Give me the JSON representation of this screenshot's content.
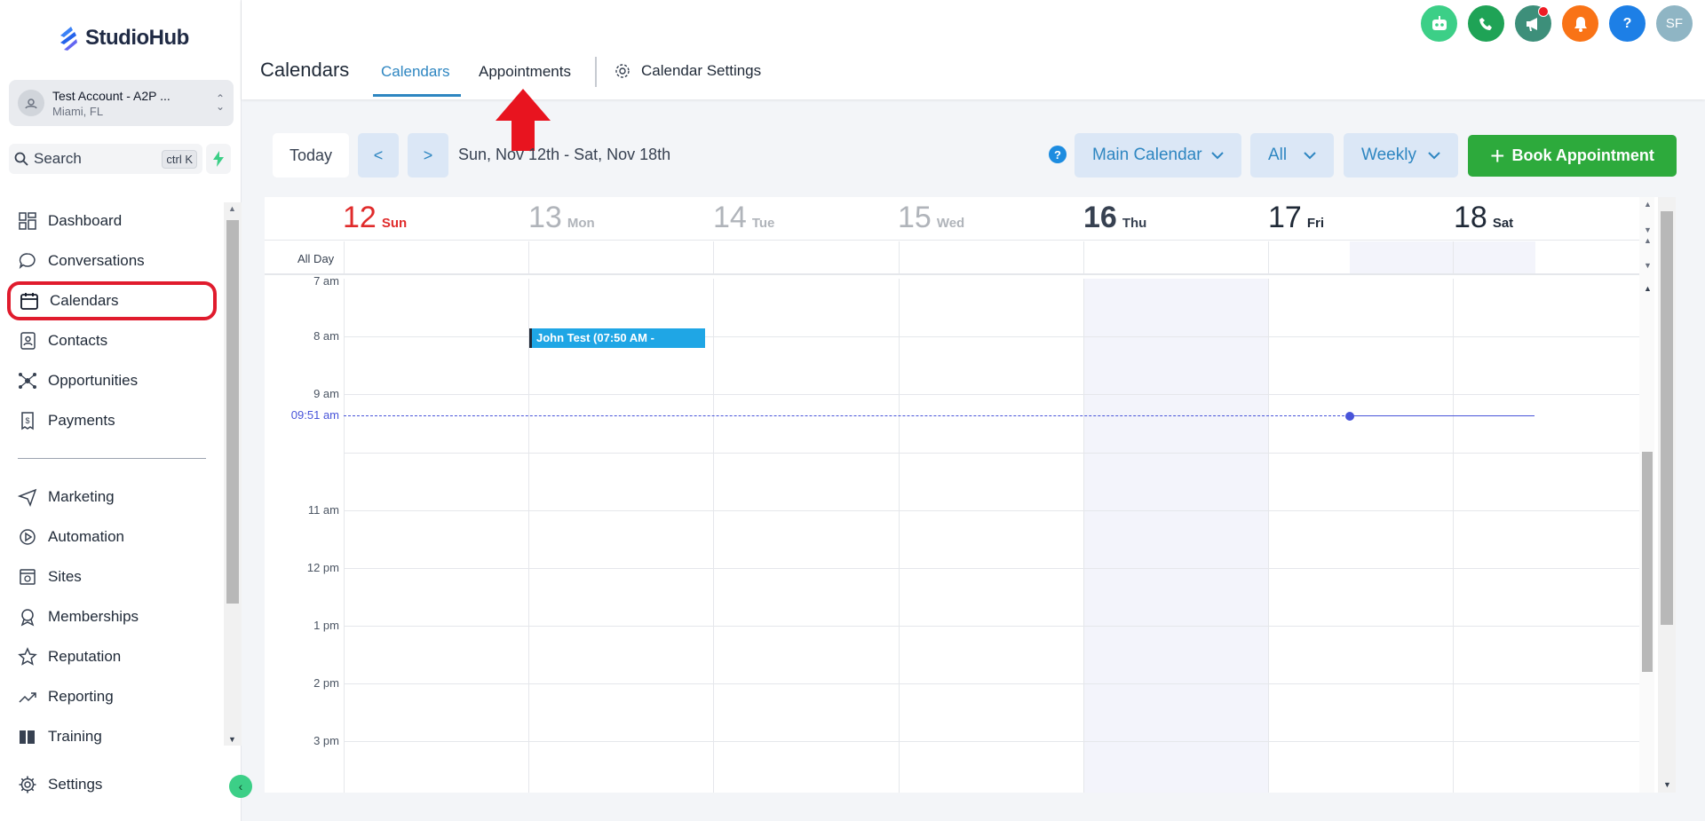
{
  "app": {
    "logo": "StudioHub"
  },
  "account": {
    "name": "Test Account - A2P ...",
    "location": "Miami, FL"
  },
  "search": {
    "label": "Search",
    "shortcut": "ctrl K"
  },
  "nav": {
    "items": [
      {
        "label": "Dashboard",
        "icon": "dashboard-icon"
      },
      {
        "label": "Conversations",
        "icon": "chat-icon"
      },
      {
        "label": "Calendars",
        "icon": "calendar-icon",
        "active": true
      },
      {
        "label": "Contacts",
        "icon": "contacts-icon"
      },
      {
        "label": "Opportunities",
        "icon": "opportunities-icon"
      },
      {
        "label": "Payments",
        "icon": "payments-icon"
      }
    ],
    "items2": [
      {
        "label": "Marketing",
        "icon": "send-icon"
      },
      {
        "label": "Automation",
        "icon": "automation-icon"
      },
      {
        "label": "Sites",
        "icon": "sites-icon"
      },
      {
        "label": "Memberships",
        "icon": "badge-icon"
      },
      {
        "label": "Reputation",
        "icon": "star-icon"
      },
      {
        "label": "Reporting",
        "icon": "trend-icon"
      },
      {
        "label": "Training",
        "icon": "book-icon"
      }
    ],
    "settings": "Settings"
  },
  "header": {
    "title": "Calendars",
    "tabs": [
      "Calendars",
      "Appointments"
    ],
    "settings_tab": "Calendar Settings",
    "avatar": "SF",
    "help": "?"
  },
  "toolbar": {
    "today": "Today",
    "prev": "<",
    "next": ">",
    "range": "Sun, Nov 12th - Sat, Nov 18th",
    "calendar_select": "Main Calendar",
    "filter_select": "All",
    "view_select": "Weekly",
    "book": "Book Appointment"
  },
  "calendar": {
    "days": [
      {
        "num": "12",
        "name": "Sun"
      },
      {
        "num": "13",
        "name": "Mon"
      },
      {
        "num": "14",
        "name": "Tue"
      },
      {
        "num": "15",
        "name": "Wed"
      },
      {
        "num": "16",
        "name": "Thu"
      },
      {
        "num": "17",
        "name": "Fri"
      },
      {
        "num": "18",
        "name": "Sat"
      }
    ],
    "all_day": "All Day",
    "times": [
      "7 am",
      "8 am",
      "9 am",
      "11 am",
      "12 pm",
      "1 pm",
      "2 pm",
      "3 pm"
    ],
    "now_label": "09:51 am",
    "event": "John Test (07:50 AM -"
  },
  "colors": {
    "accent": "#2e86c1",
    "book": "#2daa3c",
    "today": "#e02b2b",
    "now": "#4854d9"
  }
}
